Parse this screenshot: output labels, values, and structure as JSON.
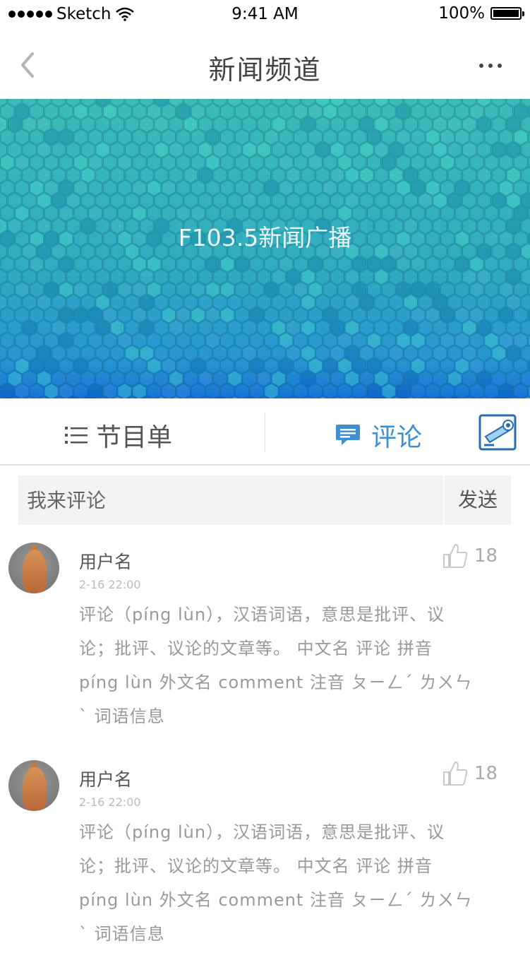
{
  "status_bar": {
    "carrier": "Sketch",
    "time": "9:41 AM",
    "battery": "100%"
  },
  "nav": {
    "title": "新闻频道"
  },
  "banner": {
    "label": "F103.5新闻广播"
  },
  "tabs": [
    {
      "label": "节目单",
      "active": false
    },
    {
      "label": "评论",
      "active": true
    }
  ],
  "comment_box": {
    "placeholder": "我来评论",
    "send_label": "发送"
  },
  "comments": [
    {
      "username": "用户名",
      "time": "2-16 22:00",
      "likes": "18",
      "text": "评论（píng lùn），汉语词语，意思是批评、议论；批评、议论的文章等。 中文名 评论 拼音 píng lùn 外文名 comment 注音 ㄆㄧㄥˊ ㄌㄨㄣˋ 词语信息"
    },
    {
      "username": "用户名",
      "time": "2-16 22:00",
      "likes": "18",
      "text": "评论（píng lùn），汉语词语，意思是批评、议论；批评、议论的文章等。 中文名 评论 拼音 píng lùn 外文名 comment 注音 ㄆㄧㄥˊ ㄌㄨㄣˋ 词语信息"
    }
  ],
  "colors": {
    "accent": "#3d8fd6",
    "banner_top": "#33b9b6",
    "banner_bottom": "#0f6fd4"
  },
  "icons": [
    "back-chevron-icon",
    "more-icon",
    "list-icon",
    "comment-bubble-icon",
    "camera-icon",
    "thumb-up-icon"
  ]
}
